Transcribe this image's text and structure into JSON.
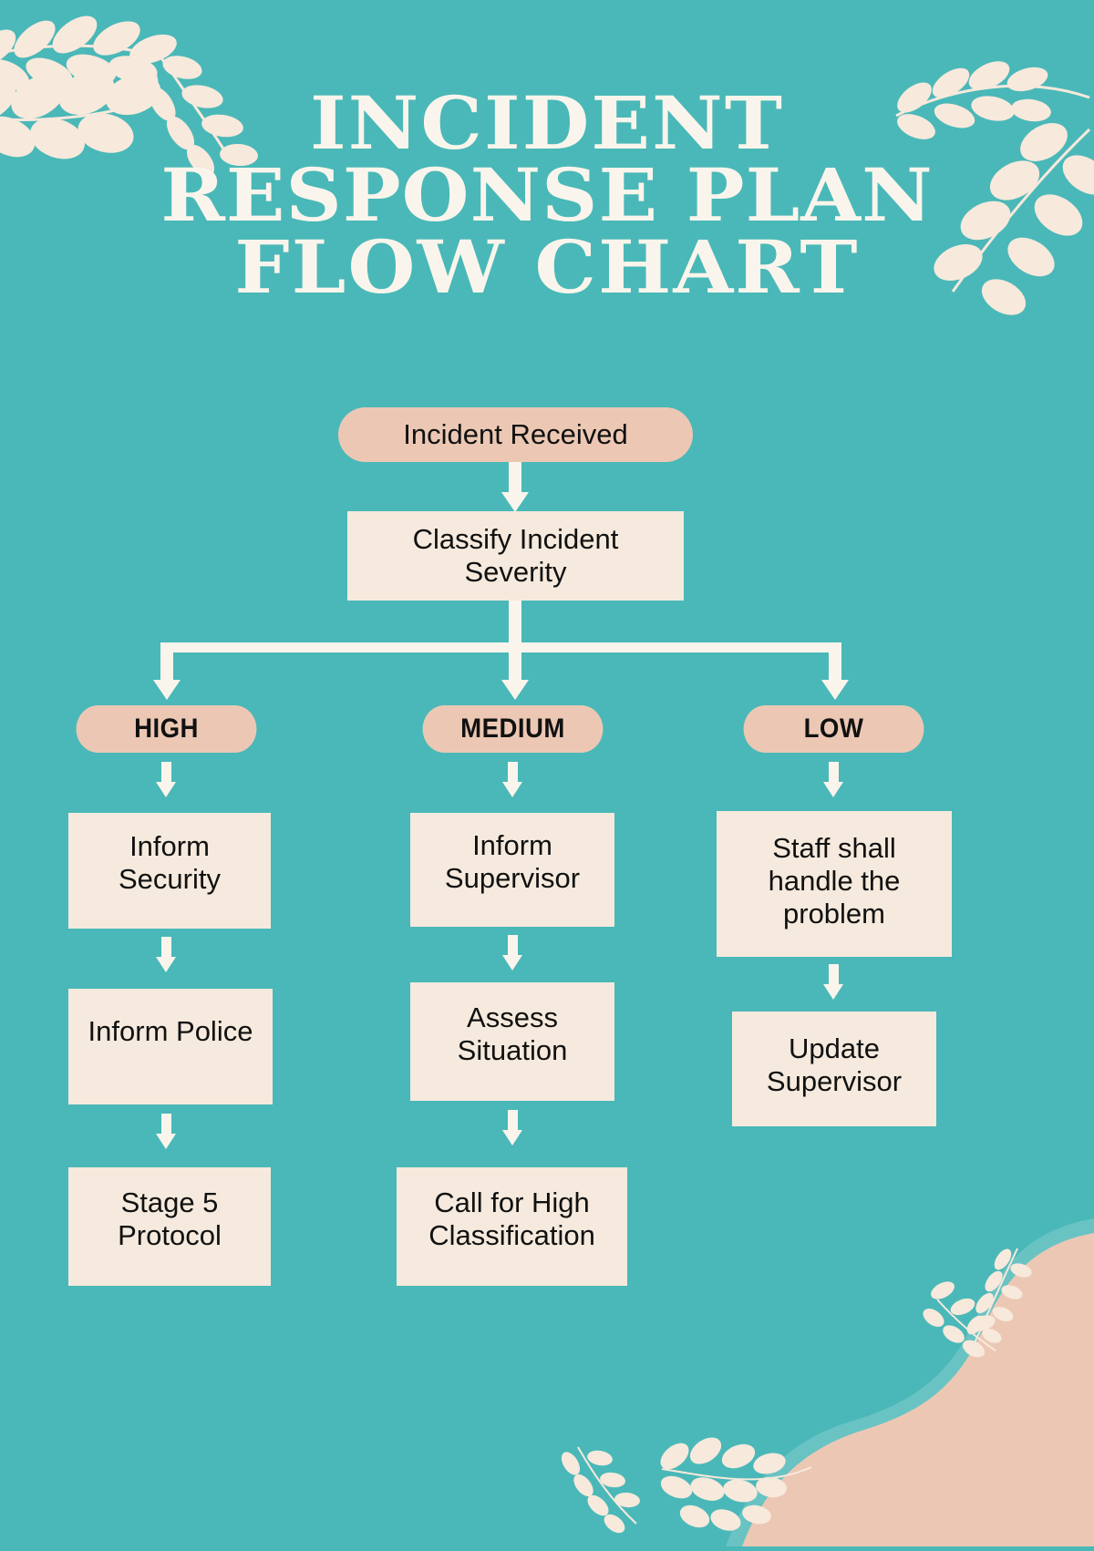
{
  "poster": {
    "background_color": "#4ab8b8",
    "accent_cream": "#f5eadd",
    "accent_peach": "#ecc8b4",
    "arrow_color": "#faf5ec",
    "title_color": "#faf5ec",
    "text_color": "#111111"
  },
  "title": {
    "line1": "INCIDENT",
    "line2": "RESPONSE PLAN",
    "line3": "FLOW CHART"
  },
  "chart_data": {
    "type": "diagram",
    "title": "INCIDENT RESPONSE PLAN FLOW CHART",
    "nodes": [
      {
        "id": "start",
        "label": "Incident Received",
        "shape": "pill",
        "color": "#ecc8b4"
      },
      {
        "id": "classify",
        "label": "Classify Incident Severity",
        "shape": "rect",
        "color": "#f5eadd"
      },
      {
        "id": "high",
        "label": "HIGH",
        "shape": "pill",
        "color": "#ecc8b4"
      },
      {
        "id": "medium",
        "label": "MEDIUM",
        "shape": "pill",
        "color": "#ecc8b4"
      },
      {
        "id": "low",
        "label": "LOW",
        "shape": "pill",
        "color": "#ecc8b4"
      },
      {
        "id": "h1",
        "label": "Inform Security",
        "shape": "rect",
        "color": "#f5eadd"
      },
      {
        "id": "h2",
        "label": "Inform Police",
        "shape": "rect",
        "color": "#f5eadd"
      },
      {
        "id": "h3",
        "label": "Stage 5 Protocol",
        "shape": "rect",
        "color": "#f5eadd"
      },
      {
        "id": "m1",
        "label": "Inform Supervisor",
        "shape": "rect",
        "color": "#f5eadd"
      },
      {
        "id": "m2",
        "label": "Assess Situation",
        "shape": "rect",
        "color": "#f5eadd"
      },
      {
        "id": "m3",
        "label": "Call for High Classification",
        "shape": "rect",
        "color": "#f5eadd"
      },
      {
        "id": "l1",
        "label": "Staff shall handle the problem",
        "shape": "rect",
        "color": "#f5eadd"
      },
      {
        "id": "l2",
        "label": "Update Supervisor",
        "shape": "rect",
        "color": "#f5eadd"
      }
    ],
    "edges": [
      {
        "from": "start",
        "to": "classify"
      },
      {
        "from": "classify",
        "to": "high"
      },
      {
        "from": "classify",
        "to": "medium"
      },
      {
        "from": "classify",
        "to": "low"
      },
      {
        "from": "high",
        "to": "h1"
      },
      {
        "from": "h1",
        "to": "h2"
      },
      {
        "from": "h2",
        "to": "h3"
      },
      {
        "from": "medium",
        "to": "m1"
      },
      {
        "from": "m1",
        "to": "m2"
      },
      {
        "from": "m2",
        "to": "m3"
      },
      {
        "from": "low",
        "to": "l1"
      },
      {
        "from": "l1",
        "to": "l2"
      }
    ]
  },
  "flow": {
    "start": "Incident Received",
    "classify_l1": "Classify Incident",
    "classify_l2": "Severity",
    "high": "HIGH",
    "medium": "MEDIUM",
    "low": "LOW",
    "high_1_l1": "Inform",
    "high_1_l2": "Security",
    "high_2": "Inform Police",
    "high_3_l1": "Stage 5",
    "high_3_l2": "Protocol",
    "med_1_l1": "Inform",
    "med_1_l2": "Supervisor",
    "med_2_l1": "Assess",
    "med_2_l2": "Situation",
    "med_3_l1": "Call for High",
    "med_3_l2": "Classification",
    "low_1_l1": "Staff shall",
    "low_1_l2": "handle the",
    "low_1_l3": "problem",
    "low_2_l1": "Update",
    "low_2_l2": "Supervisor"
  },
  "decorations": {
    "leaf_top_left": "leaf-branch-icon",
    "leaf_top_left_2": "leaf-branch-icon",
    "leaf_top_right": "leaf-branch-icon",
    "leaf_top_right_2": "leaf-branch-icon",
    "leaf_bottom_center": "leaf-sprig-icon",
    "leaf_bottom_center_2": "leaf-sprig-icon",
    "leaf_bottom_right": "leaf-sprig-icon",
    "corner_blob": "organic-blob-shape"
  }
}
